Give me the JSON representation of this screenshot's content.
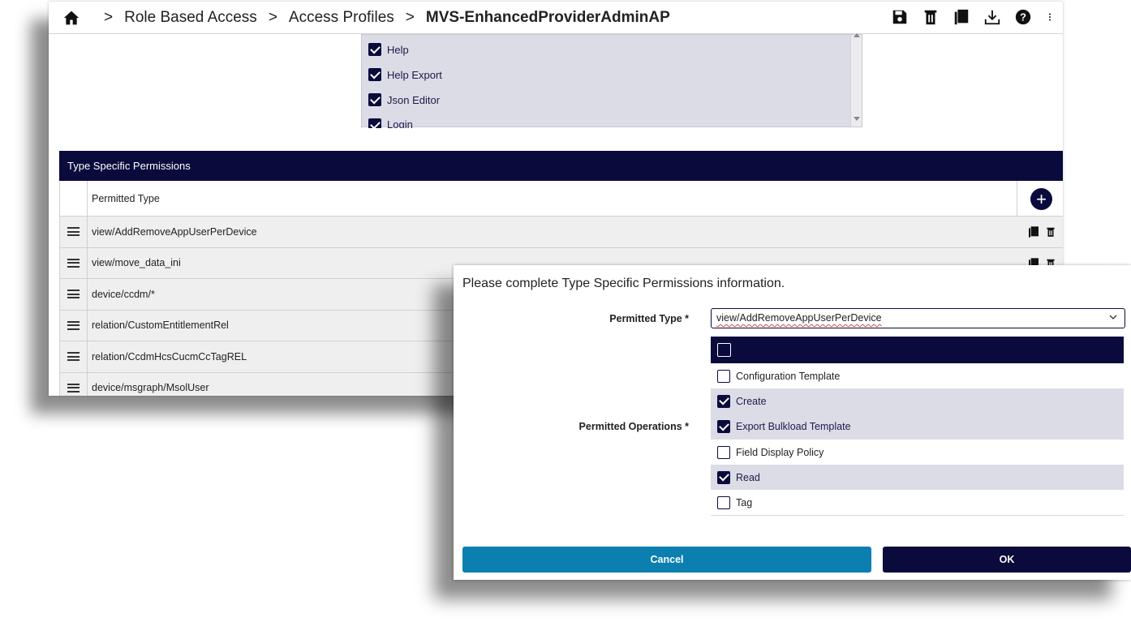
{
  "breadcrumb": {
    "items": [
      "Role Based Access",
      "Access Profiles"
    ],
    "current": "MVS-EnhancedProviderAdminAP"
  },
  "toolbar_icons": [
    "save-icon",
    "delete-icon",
    "copy-icon",
    "download-icon",
    "help-icon",
    "more-vert-icon"
  ],
  "permissions_list": [
    {
      "label": "Help",
      "checked": true
    },
    {
      "label": "Help Export",
      "checked": true
    },
    {
      "label": "Json Editor",
      "checked": true
    },
    {
      "label": "Login",
      "checked": true
    }
  ],
  "type_specific": {
    "title": "Type Specific Permissions",
    "column_header": "Permitted Type",
    "rows": [
      "view/AddRemoveAppUserPerDevice",
      "view/move_data_ini",
      "device/ccdm/*",
      "relation/CustomEntitlementRel",
      "relation/CcdmHcsCucmCcTagREL",
      "device/msgraph/MsolUser"
    ]
  },
  "dialog": {
    "title": "Please complete Type Specific Permissions information.",
    "permitted_type_label": "Permitted Type *",
    "permitted_type_value": "view/AddRemoveAppUserPerDevice",
    "permitted_operations_label": "Permitted Operations *",
    "operations": [
      {
        "label": "Configuration Template",
        "checked": false
      },
      {
        "label": "Create",
        "checked": true
      },
      {
        "label": "Export Bulkload Template",
        "checked": true
      },
      {
        "label": "Field Display Policy",
        "checked": false
      },
      {
        "label": "Read",
        "checked": true
      },
      {
        "label": "Tag",
        "checked": false
      }
    ],
    "cancel_label": "Cancel",
    "ok_label": "OK"
  },
  "colors": {
    "navy": "#0a0a3c",
    "cancel_blue": "#0a7fb0",
    "checked_row": "#dcdce6"
  }
}
